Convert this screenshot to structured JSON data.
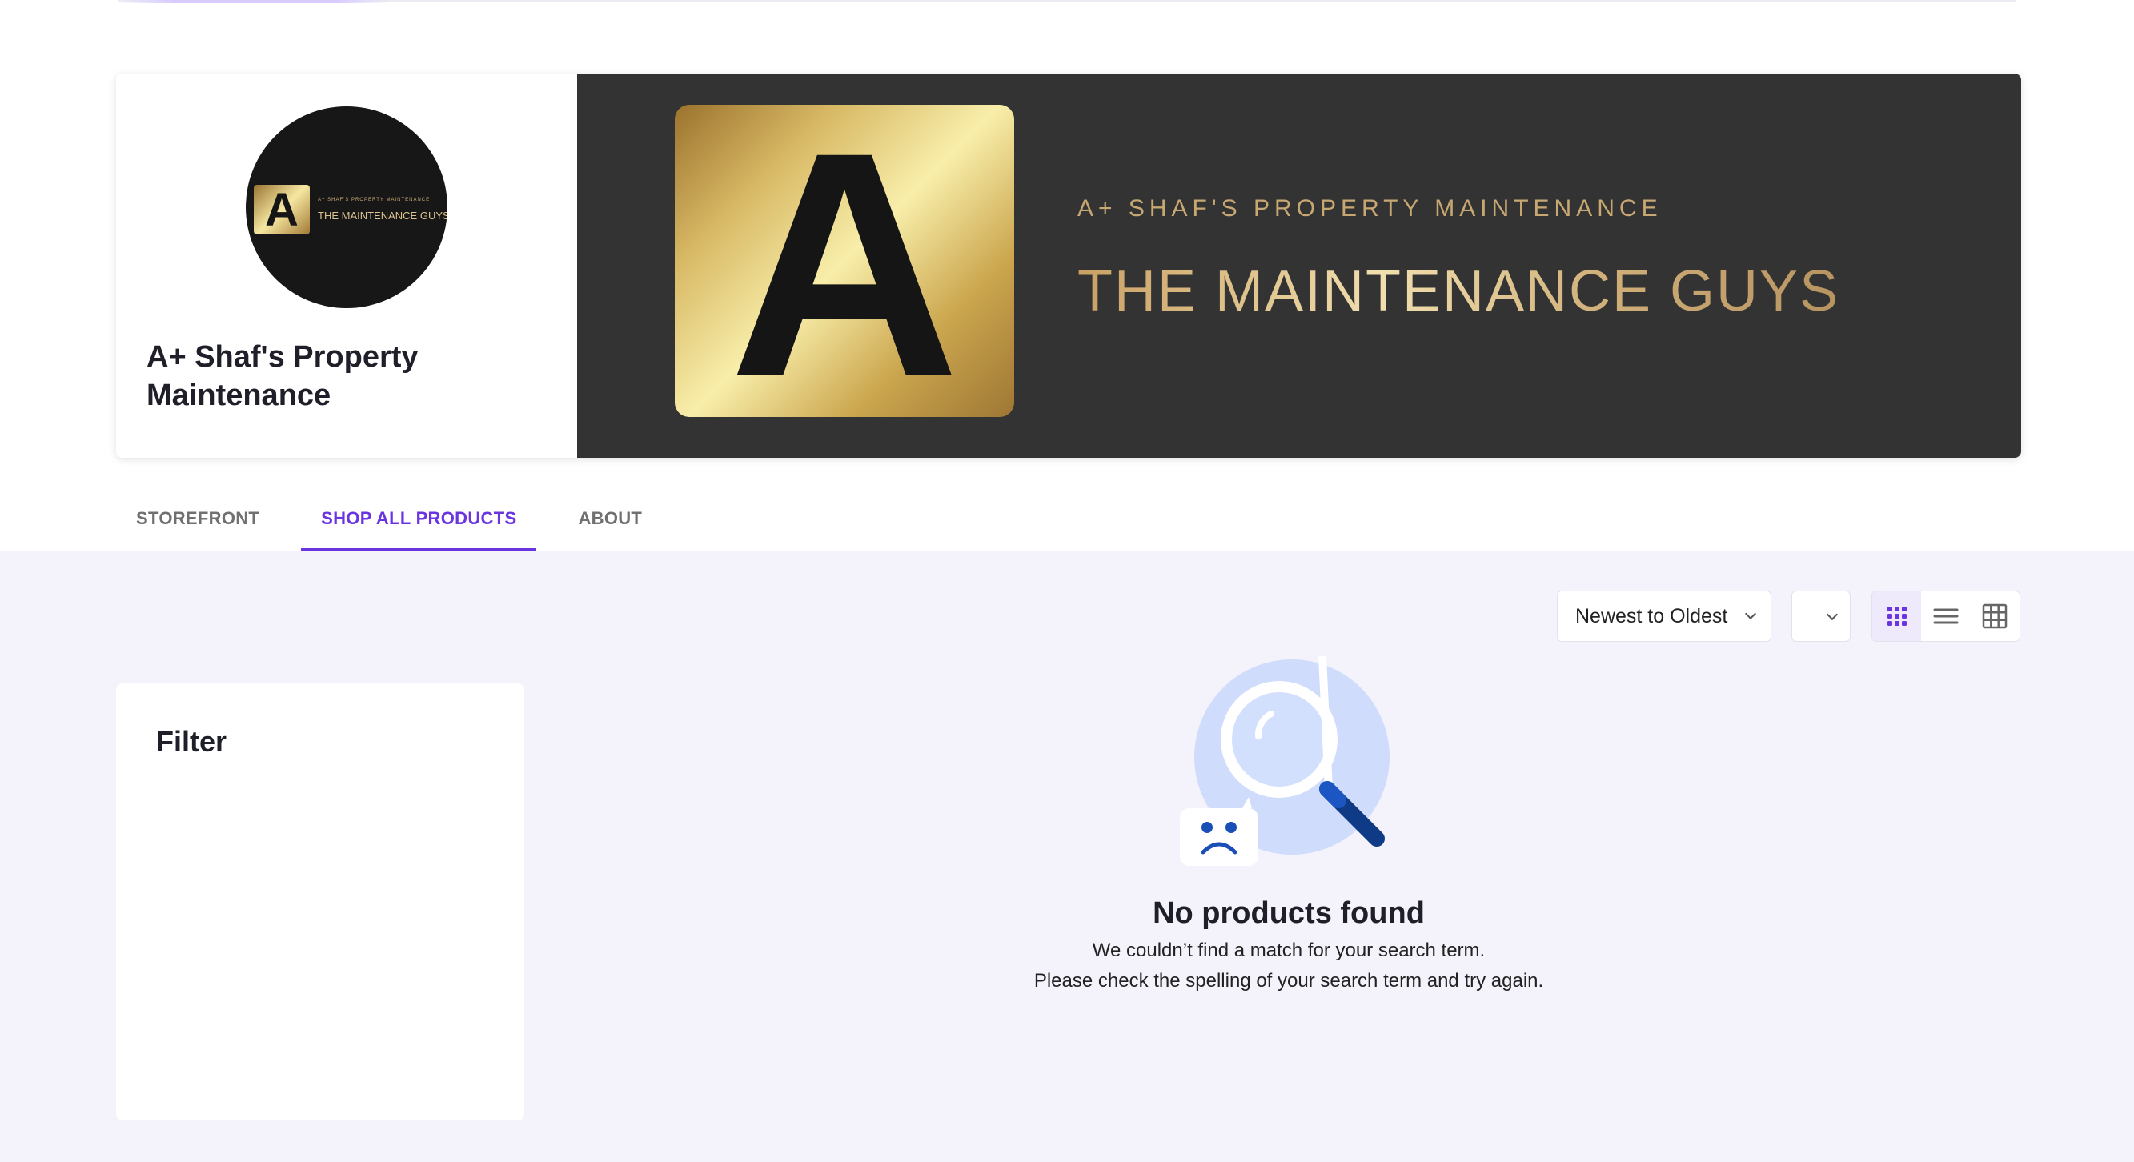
{
  "store": {
    "name": "A+ Shaf's Property Maintenance",
    "avatar_logo": {
      "letter": "A",
      "small_text": "A+ SHAF'S PROPERTY MAINTENANCE",
      "big_text": "THE MAINTENANCE GUYS"
    },
    "banner": {
      "letter": "A",
      "subtitle": "A+ SHAF'S PROPERTY MAINTENANCE",
      "title": "THE MAINTENANCE GUYS"
    }
  },
  "tabs": [
    {
      "label": "STOREFRONT",
      "active": false
    },
    {
      "label": "SHOP ALL PRODUCTS",
      "active": true
    },
    {
      "label": "ABOUT",
      "active": false
    }
  ],
  "toolbar": {
    "sort_value": "Newest to Oldest",
    "page_size_value": "",
    "views": [
      {
        "icon": "grid-dots-icon",
        "active": true
      },
      {
        "icon": "list-icon",
        "active": false
      },
      {
        "icon": "table-grid-icon",
        "active": false
      }
    ]
  },
  "filter": {
    "title": "Filter"
  },
  "empty_state": {
    "title": "No products found",
    "line1": "We couldn’t find a match for your search term.",
    "line2": "Please check the spelling of your search term and try again.",
    "icon": "magnifier-sad-face-icon"
  },
  "colors": {
    "accent": "#6a34e0",
    "background": "#f4f3fb",
    "banner": "#333333",
    "gold": "#c9a064"
  }
}
